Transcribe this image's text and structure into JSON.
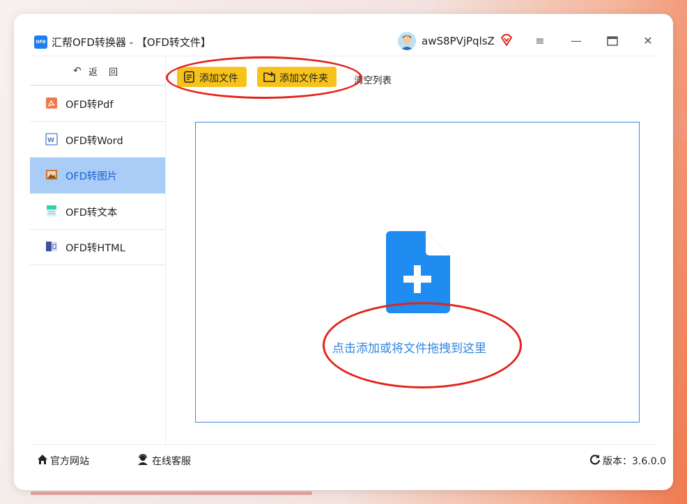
{
  "window": {
    "title": "汇帮OFD转换器 - 【OFD转文件】",
    "logo_text": "OFD",
    "username": "awS8PVjPqlsZ"
  },
  "sidebar": {
    "back_label": "返 回",
    "items": [
      {
        "label": "OFD转Pdf",
        "icon": "pdf-icon",
        "active": false
      },
      {
        "label": "OFD转Word",
        "icon": "word-icon",
        "active": false
      },
      {
        "label": "OFD转图片",
        "icon": "image-icon",
        "active": true
      },
      {
        "label": "OFD转文本",
        "icon": "text-icon",
        "active": false
      },
      {
        "label": "OFD转HTML",
        "icon": "html-icon",
        "active": false
      }
    ]
  },
  "toolbar": {
    "add_file": "添加文件",
    "add_folder": "添加文件夹",
    "clear_list": "清空列表"
  },
  "dropzone": {
    "text": "点击添加或将文件拖拽到这里"
  },
  "footer": {
    "website": "官方网站",
    "support": "在线客服",
    "version": "版本：3.6.0.0"
  },
  "colors": {
    "accent_yellow": "#f7c31b",
    "active_nav": "#a9cdf6",
    "primary_blue": "#2f86df",
    "highlight_red": "#e3231c"
  }
}
